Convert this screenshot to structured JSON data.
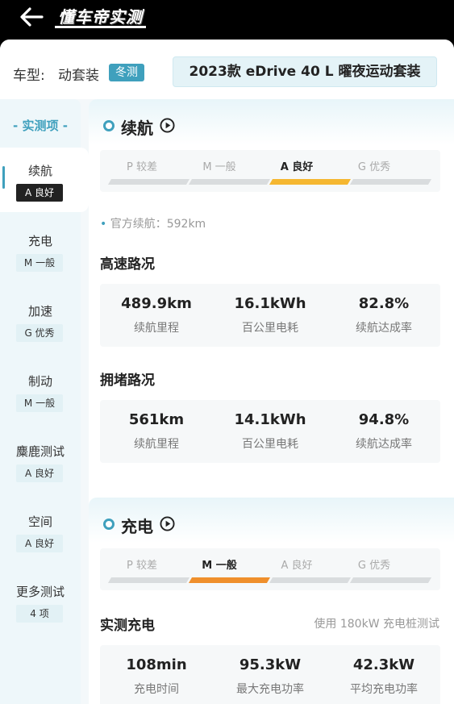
{
  "header": {
    "brand": "懂车帝实测"
  },
  "model": {
    "label": "车型:",
    "partial_text": "动套装",
    "winter_badge": "冬测",
    "selected": "2023款 eDrive 40 L 曜夜运动套装"
  },
  "sidebar": {
    "title": "- 实测项 -",
    "items": [
      {
        "label": "续航",
        "grade": "A 良好",
        "active": true
      },
      {
        "label": "充电",
        "grade": "M 一般"
      },
      {
        "label": "加速",
        "grade": "G 优秀"
      },
      {
        "label": "制动",
        "grade": "M 一般"
      },
      {
        "label": "麋鹿测试",
        "grade": "A 良好"
      },
      {
        "label": "空间",
        "grade": "A 良好"
      },
      {
        "label": "更多测试",
        "grade": "4 项"
      }
    ]
  },
  "range": {
    "title": "续航",
    "grades": [
      "P 较差",
      "M 一般",
      "A 良好",
      "G 优秀"
    ],
    "selected_grade": "A 良好",
    "official_label": "官方续航：592km",
    "highway": {
      "title": "高速路况",
      "stats": [
        {
          "value": "489.9km",
          "label": "续航里程"
        },
        {
          "value": "16.1kWh",
          "label": "百公里电耗"
        },
        {
          "value": "82.8%",
          "label": "续航达成率"
        }
      ]
    },
    "congested": {
      "title": "拥堵路况",
      "stats": [
        {
          "value": "561km",
          "label": "续航里程"
        },
        {
          "value": "14.1kWh",
          "label": "百公里电耗"
        },
        {
          "value": "94.8%",
          "label": "续航达成率"
        }
      ]
    }
  },
  "charging": {
    "title": "充电",
    "grades": [
      "P 较差",
      "M 一般",
      "A 良好",
      "G 优秀"
    ],
    "selected_grade": "M 一般",
    "measured": {
      "title": "实测充电",
      "note": "使用 180kW 充电桩测试",
      "stats": [
        {
          "value": "108min",
          "label": "充电时间"
        },
        {
          "value": "95.3kW",
          "label": "最大充电功率"
        },
        {
          "value": "42.3kW",
          "label": "平均充电功率"
        }
      ]
    }
  },
  "colors": {
    "accent": "#3fa0bd",
    "grade_good": "#f5b731",
    "grade_average": "#ef8f2c"
  }
}
